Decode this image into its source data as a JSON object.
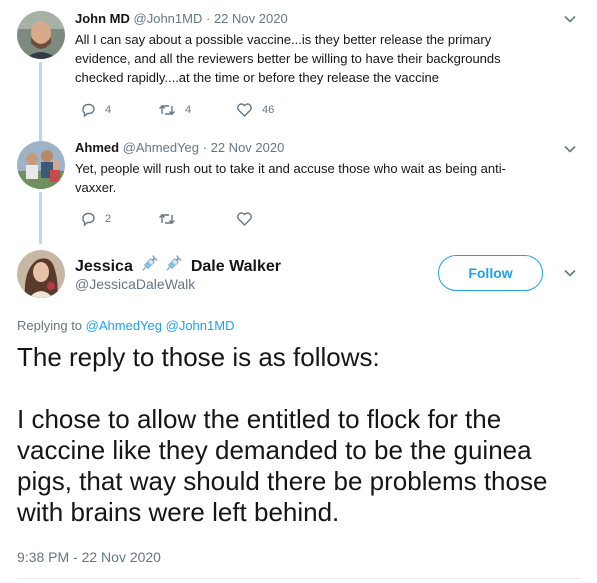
{
  "replies": [
    {
      "display_name": "John MD",
      "handle": "@John1MD",
      "separator": "·",
      "date": "22 Nov 2020",
      "lines": [
        "All I can say about a possible vaccine...is they better release the primary",
        "evidence, and all the reviewers better be willing to have their backgrounds",
        "checked rapidly....at the time or before they release the vaccine"
      ],
      "reply_count": "4",
      "retweet_count": "4",
      "like_count": "46",
      "icons": [
        "reply-icon",
        "retweet-icon",
        "like-icon",
        "chevron-down-icon"
      ]
    },
    {
      "display_name": "Ahmed",
      "handle": "@AhmedYeg",
      "separator": "·",
      "date": "22 Nov 2020",
      "lines": [
        "Yet, people will rush out to take it and accuse those who wait as being anti-",
        "vaxxer."
      ],
      "reply_count": "2",
      "retweet_count": "",
      "like_count": "",
      "icons": [
        "reply-icon",
        "retweet-icon",
        "like-icon",
        "chevron-down-icon"
      ]
    }
  ],
  "main_tweet": {
    "display_name_first": "Jessica",
    "display_name_last": "Dale Walker",
    "name_emoji": [
      "syringe-icon",
      "syringe-icon"
    ],
    "handle": "@JessicaDaleWalk",
    "follow_label": "Follow",
    "replying_prefix": "Replying to",
    "replying_to": [
      "@AhmedYeg",
      "@John1MD"
    ],
    "paragraphs": [
      "The reply to those is as follows:",
      "I chose to allow the entitled to flock for the vaccine like they demanded to be the guinea pigs, that way should there be problems those with brains were left behind."
    ],
    "timestamp": "9:38 PM - 22 Nov 2020"
  },
  "colors": {
    "accent": "#1da1f2",
    "muted": "#657786",
    "text": "#14171a",
    "thread_line": "#b5d8f5"
  }
}
